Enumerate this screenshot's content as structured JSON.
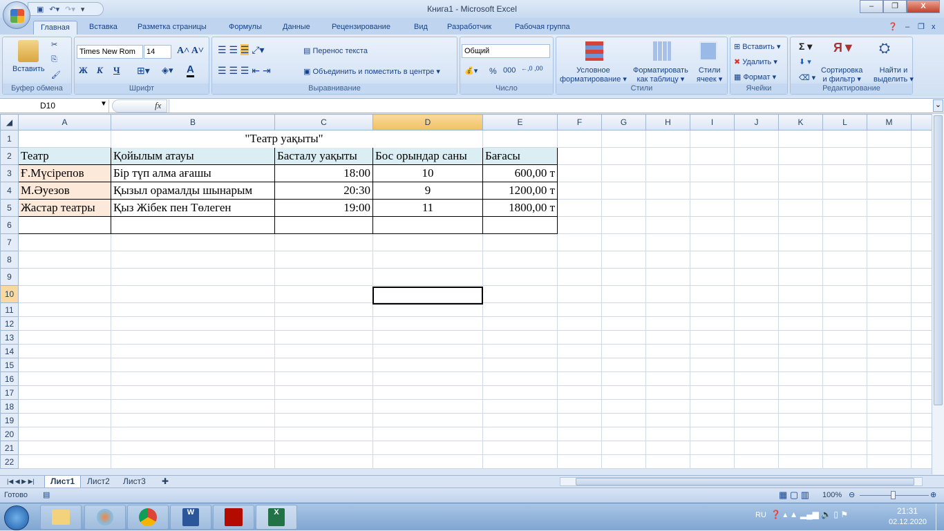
{
  "window": {
    "title": "Книга1 - Microsoft Excel",
    "minimize": "–",
    "restore": "❐",
    "close": "X"
  },
  "tabs": [
    "Главная",
    "Вставка",
    "Разметка страницы",
    "Формулы",
    "Данные",
    "Рецензирование",
    "Вид",
    "Разработчик",
    "Рабочая группа"
  ],
  "ribbon": {
    "clipboard": {
      "label": "Буфер обмена",
      "paste": "Вставить"
    },
    "font": {
      "label": "Шрифт",
      "name": "Times New Rom",
      "size": "14",
      "bold": "Ж",
      "italic": "К",
      "underline": "Ч"
    },
    "alignment": {
      "label": "Выравнивание",
      "wrap": "Перенос текста",
      "merge": "Объединить и поместить в центре"
    },
    "number": {
      "label": "Число",
      "format": "Общий",
      "percent": "%",
      "thousands": "000"
    },
    "styles": {
      "label": "Стили",
      "conditional": [
        "Условное",
        "форматирование"
      ],
      "table": [
        "Форматировать",
        "как таблицу"
      ],
      "cell": [
        "Стили",
        "ячеек"
      ]
    },
    "cells": {
      "label": "Ячейки",
      "insert": "Вставить",
      "delete": "Удалить",
      "format": "Формат"
    },
    "editing": {
      "label": "Редактирование",
      "sort": [
        "Сортировка",
        "и фильтр"
      ],
      "find": [
        "Найти и",
        "выделить"
      ],
      "sum": "Σ"
    }
  },
  "formula_bar": {
    "name_box": "D10",
    "fx": "fx",
    "value": ""
  },
  "columns": [
    "A",
    "B",
    "C",
    "D",
    "E",
    "F",
    "G",
    "H",
    "I",
    "J",
    "K",
    "L",
    "M"
  ],
  "sheet": {
    "title": "\"Театр уақыты\"",
    "headers": [
      "Театр",
      "Қойылым атауы",
      "Басталу уақыты",
      "Бос орындар саны",
      "Бағасы"
    ],
    "rows": [
      [
        "Ғ.Мүсірепов",
        "Бір түп алма ағашы",
        "18:00",
        "10",
        "600,00 т"
      ],
      [
        "М.Әуезов",
        "Қызыл орамалды шынарым",
        "20:30",
        "9",
        "1200,00 т"
      ],
      [
        "Жастар театры",
        "Қыз Жібек пен Төлеген",
        "19:00",
        "11",
        "1800,00 т"
      ]
    ]
  },
  "sheet_tabs": [
    "Лист1",
    "Лист2",
    "Лист3"
  ],
  "status": {
    "ready": "Готово",
    "zoom": "100%"
  },
  "tray": {
    "lang": "RU",
    "time": "21:31",
    "date": "02.12.2020"
  }
}
